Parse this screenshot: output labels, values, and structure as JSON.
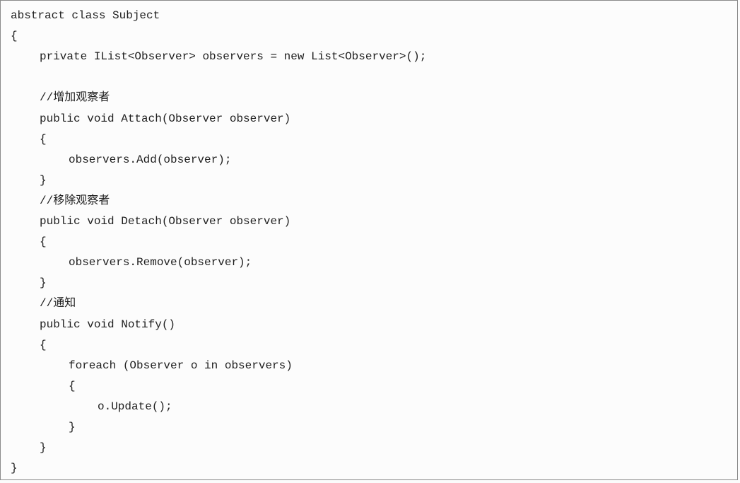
{
  "code": {
    "lines": [
      {
        "indent": 0,
        "text": "abstract class Subject"
      },
      {
        "indent": 0,
        "text": "{"
      },
      {
        "indent": 1,
        "text": "private IList<Observer> observers = new List<Observer>();"
      },
      {
        "indent": 0,
        "text": ""
      },
      {
        "indent": 1,
        "text": "//增加观察者"
      },
      {
        "indent": 1,
        "text": "public void Attach(Observer observer)"
      },
      {
        "indent": 1,
        "text": "{"
      },
      {
        "indent": 2,
        "text": "observers.Add(observer);"
      },
      {
        "indent": 1,
        "text": "}"
      },
      {
        "indent": 1,
        "text": "//移除观察者"
      },
      {
        "indent": 1,
        "text": "public void Detach(Observer observer)"
      },
      {
        "indent": 1,
        "text": "{"
      },
      {
        "indent": 2,
        "text": "observers.Remove(observer);"
      },
      {
        "indent": 1,
        "text": "}"
      },
      {
        "indent": 1,
        "text": "//通知"
      },
      {
        "indent": 1,
        "text": "public void Notify()"
      },
      {
        "indent": 1,
        "text": "{"
      },
      {
        "indent": 2,
        "text": "foreach (Observer o in observers)"
      },
      {
        "indent": 2,
        "text": "{"
      },
      {
        "indent": 3,
        "text": "o.Update();"
      },
      {
        "indent": 2,
        "text": "}"
      },
      {
        "indent": 1,
        "text": "}"
      },
      {
        "indent": 0,
        "text": "}"
      }
    ]
  }
}
